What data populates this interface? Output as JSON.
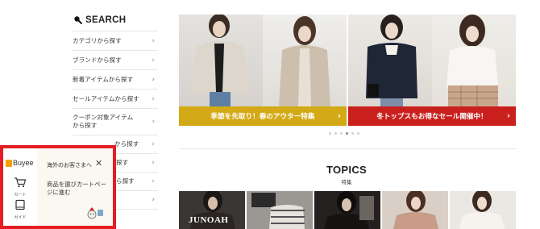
{
  "sidebar": {
    "heading": "SEARCH",
    "items": [
      {
        "label": "カテゴリから探す"
      },
      {
        "label": "ブランドから探す"
      },
      {
        "label": "新着アイテムから探す"
      },
      {
        "label": "セールアイテムから探す"
      },
      {
        "label": "クーポン対象アイテムから探す"
      },
      {
        "label": "から探す"
      },
      {
        "label": "探す"
      },
      {
        "label": "ら探す"
      },
      {
        "label": ""
      }
    ]
  },
  "banner": {
    "left_caption": "季節を先取り！春のアウター特集",
    "right_caption": "冬トップスもお得なセール開催中！",
    "colors": {
      "left_bar": "#d3a915",
      "right_bar": "#c9201e"
    },
    "dots": 6,
    "active_dot": 4
  },
  "topics": {
    "title": "TOPICS",
    "subtitle": "特集",
    "thumbs": [
      {
        "text": "JUNOAH"
      },
      {
        "text": ""
      },
      {
        "text": ""
      },
      {
        "text": ""
      },
      {
        "text": ""
      }
    ]
  },
  "buyee": {
    "logo": "Buyee",
    "cart_label": "カート",
    "guide_label": "ガイド",
    "bubble_title": "海外のお客さまへ",
    "bubble_message": "商品を選びカートページに進む",
    "border_color": "#e21d24"
  }
}
